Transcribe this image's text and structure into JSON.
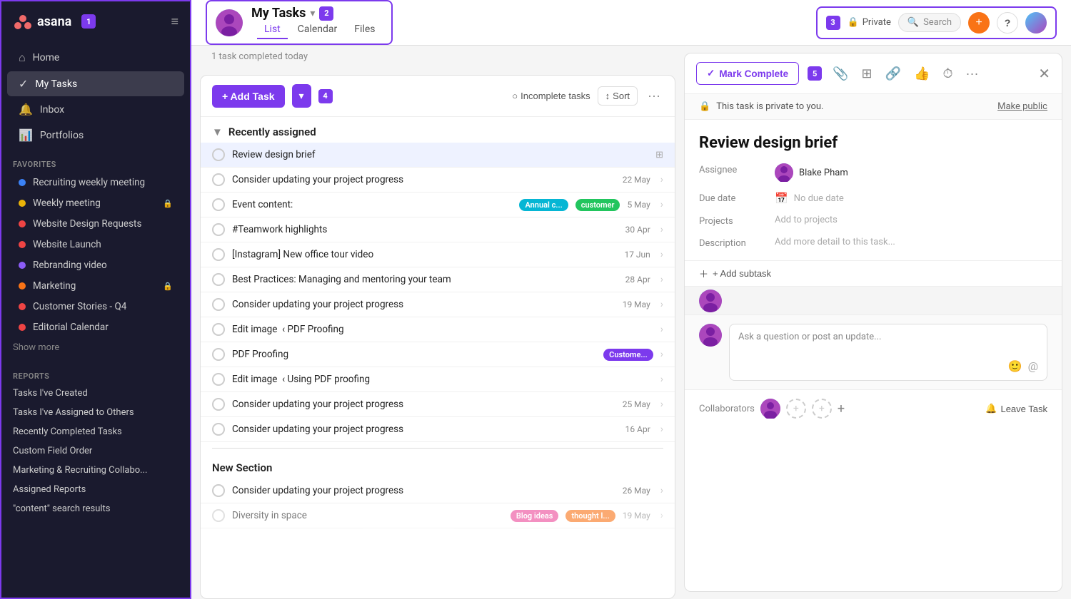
{
  "sidebar": {
    "logo": "asana",
    "badge1": "1",
    "nav": [
      {
        "label": "Home",
        "icon": "⌂",
        "active": false
      },
      {
        "label": "My Tasks",
        "icon": "✓",
        "active": true
      },
      {
        "label": "Inbox",
        "icon": "🔔",
        "active": false
      },
      {
        "label": "Portfolios",
        "icon": "📊",
        "active": false
      }
    ],
    "favorites_label": "Favorites",
    "favorites": [
      {
        "label": "Recruiting weekly meeting",
        "color": "#3b82f6"
      },
      {
        "label": "Weekly meeting",
        "color": "#eab308",
        "lock": true
      },
      {
        "label": "Website Design Requests",
        "color": "#ef4444"
      },
      {
        "label": "Website Launch",
        "color": "#ef4444"
      },
      {
        "label": "Rebranding video",
        "color": "#8b5cf6"
      },
      {
        "label": "Marketing",
        "color": "#f97316",
        "lock": true
      },
      {
        "label": "Customer Stories - Q4",
        "color": "#ef4444"
      },
      {
        "label": "Editorial Calendar",
        "color": "#ef4444"
      }
    ],
    "show_more": "Show more",
    "reports_label": "Reports",
    "reports": [
      "Tasks I've Created",
      "Tasks I've Assigned to Others",
      "Recently Completed Tasks",
      "Custom Field Order",
      "Marketing & Recruiting Collabo...",
      "Assigned Reports",
      "\"content\" search results"
    ]
  },
  "topbar": {
    "my_tasks": "My Tasks",
    "badge2": "2",
    "tabs": [
      "List",
      "Calendar",
      "Files"
    ],
    "active_tab": "List",
    "completed_text": "1 task completed today",
    "private_label": "Private",
    "badge3": "3",
    "search_placeholder": "Search",
    "sort_label": "Sort",
    "incomplete_label": "Incomplete tasks"
  },
  "task_list": {
    "badge4": "4",
    "add_task": "+ Add Task",
    "section_recently": "Recently assigned",
    "tasks": [
      {
        "name": "Review design brief",
        "date": "",
        "selected": true,
        "tags": []
      },
      {
        "name": "Consider updating your project progress",
        "date": "22 May",
        "tags": []
      },
      {
        "name": "Event content:",
        "date": "5 May",
        "tags": [
          "Annual c...",
          "customer"
        ]
      },
      {
        "name": "#Teamwork highlights",
        "date": "30 Apr",
        "tags": []
      },
      {
        "name": "[Instagram] New office tour video",
        "date": "17 Jun",
        "tags": []
      },
      {
        "name": "Best Practices: Managing and mentoring your team",
        "date": "28 Apr",
        "tags": []
      },
      {
        "name": "Consider updating your project progress",
        "date": "19 May",
        "tags": []
      },
      {
        "name": "Edit image  ‹ PDF Proofing",
        "date": "",
        "tags": []
      },
      {
        "name": "PDF Proofing",
        "date": "",
        "tags": [
          "Custome..."
        ]
      },
      {
        "name": "Edit image  ‹ Using PDF proofing",
        "date": "",
        "tags": []
      },
      {
        "name": "Consider updating your project progress",
        "date": "25 May",
        "tags": []
      },
      {
        "name": "Consider updating your project progress",
        "date": "16 Apr",
        "tags": []
      }
    ],
    "new_section": "New Section",
    "new_section_tasks": [
      {
        "name": "Consider updating your project progress",
        "date": "26 May",
        "tags": []
      },
      {
        "name": "Diversity in space",
        "date": "19 May",
        "tags": [
          "Blog ideas",
          "thought l..."
        ],
        "partial": true
      }
    ]
  },
  "detail": {
    "badge5": "5",
    "mark_complete": "Mark Complete",
    "private_notice": "This task is private to you.",
    "make_public": "Make public",
    "title": "Review design brief",
    "assignee_label": "Assignee",
    "assignee_name": "Blake Pham",
    "due_date_label": "Due date",
    "due_date": "No due date",
    "projects_label": "Projects",
    "projects_value": "Add to projects",
    "description_label": "Description",
    "description_placeholder": "Add more detail to this task...",
    "add_subtask": "+ Add subtask",
    "comment_placeholder": "Ask a question or post an update...",
    "collaborators_label": "Collaborators",
    "leave_task": "Leave Task"
  }
}
